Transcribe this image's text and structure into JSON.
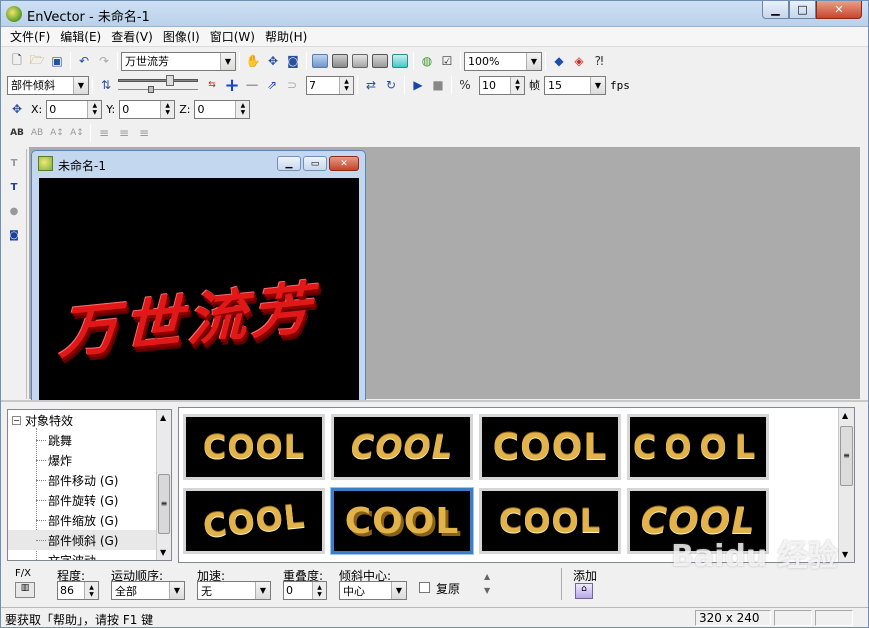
{
  "window": {
    "title": "EnVector - 未命名-1"
  },
  "menu": [
    "文件(F)",
    "编辑(E)",
    "查看(V)",
    "图像(I)",
    "窗口(W)",
    "帮助(H)"
  ],
  "toolbar": {
    "font_name": "万世流芳",
    "zoom": "100%",
    "effect": "部件倾斜",
    "frame_value": "7",
    "count_value": "10",
    "frame_label": "帧",
    "fps_value": "15",
    "fps_label": "fps",
    "x_label": "X:",
    "x_value": "0",
    "y_label": "Y:",
    "y_value": "0",
    "z_label": "Z:",
    "z_value": "0"
  },
  "child_window": {
    "title": "未命名-1"
  },
  "canvas_text": "万世流芳",
  "tree": {
    "root": "对象特效",
    "items": [
      "跳舞",
      "爆炸",
      "部件移动 (G)",
      "部件旋转 (G)",
      "部件缩放 (G)",
      "部件倾斜 (G)",
      "文字波动"
    ]
  },
  "gallery": {
    "thumbs": [
      "COOL",
      "COOL",
      "COOL",
      "COOL",
      "COOL",
      "COOL",
      "COOL",
      "COOL"
    ]
  },
  "props": {
    "fx_label": "F/X",
    "degree_label": "程度:",
    "degree_value": "86",
    "order_label": "运动顺序:",
    "order_value": "全部",
    "accel_label": "加速:",
    "accel_value": "无",
    "overlap_label": "重叠度:",
    "overlap_value": "0",
    "center_label": "倾斜中心:",
    "center_value": "中心",
    "reset_label": "复原",
    "add_label": "添加"
  },
  "status": {
    "help_text": "要获取「帮助」，请按 F1 键",
    "size": "320 x 240"
  },
  "watermark": "Baidu 经验"
}
